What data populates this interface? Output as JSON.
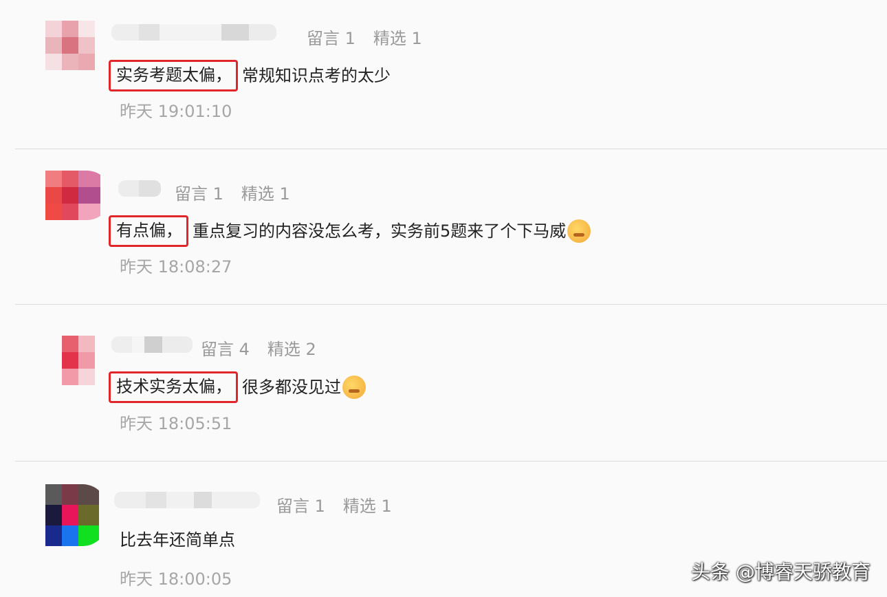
{
  "comments": [
    {
      "meta_reply": "留言 1",
      "meta_select": "精选 1",
      "highlight": "实务考题太偏，",
      "text": "常规知识点考的太少",
      "emoji": "",
      "time": "昨天 19:01:10"
    },
    {
      "meta_reply": "留言 1",
      "meta_select": "精选 1",
      "highlight": "有点偏，",
      "text": "重点复习的内容没怎么考，实务前5题来了个下马威",
      "emoji": "crying-laughing-emoji",
      "time": "昨天 18:08:27"
    },
    {
      "meta_reply": "留言 4",
      "meta_select": "精选 2",
      "highlight": "技术实务太偏，",
      "text": "很多都没见过",
      "emoji": "drooling-emoji",
      "time": "昨天 18:05:51"
    },
    {
      "meta_reply": "留言 1",
      "meta_select": "精选 1",
      "highlight": "",
      "text": "比去年还简单点",
      "emoji": "",
      "time": "昨天 18:00:05"
    }
  ],
  "watermark": "头条 @博睿天骄教育",
  "colors": {
    "highlight_border": "#e0262a",
    "meta_text": "#9a9a9a",
    "body_text": "#222222",
    "background": "#fafafb"
  }
}
